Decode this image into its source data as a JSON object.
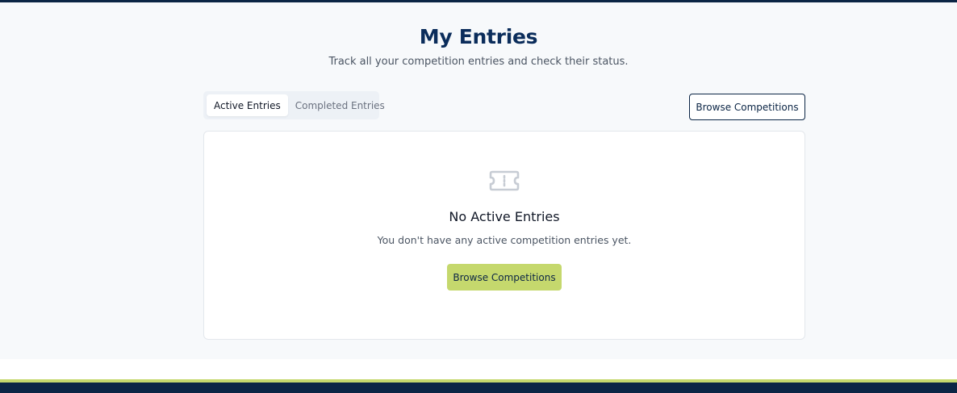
{
  "header": {
    "title": "My Entries",
    "subtitle": "Track all your competition entries and check their status."
  },
  "tabs": [
    {
      "label": "Active Entries",
      "active": true
    },
    {
      "label": "Completed Entries",
      "active": false
    }
  ],
  "toolbar": {
    "browse_label": "Browse Competitions"
  },
  "empty_state": {
    "icon": "ticket-icon",
    "title": "No Active Entries",
    "text": "You don't have any active competition entries yet.",
    "button_label": "Browse Competitions"
  },
  "colors": {
    "navy": "#0b2545",
    "accent": "#c5d86d",
    "icon_gray": "#c7ccd4"
  }
}
